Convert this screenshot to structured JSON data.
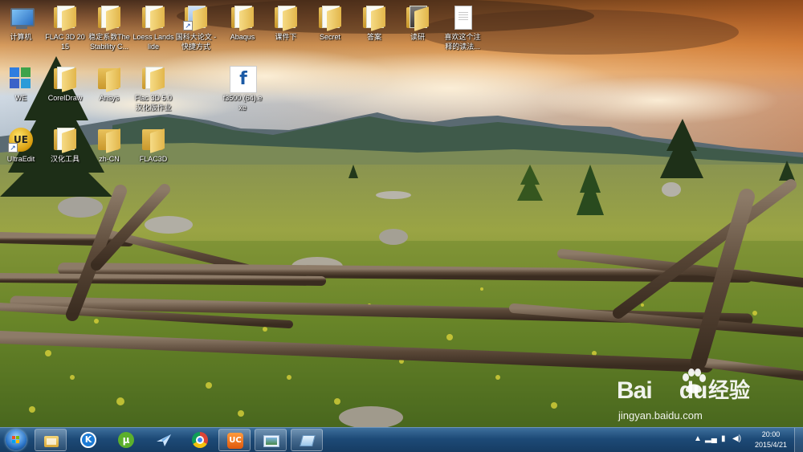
{
  "desktop": {
    "icons": [
      {
        "label": "计算机",
        "kind": "computer"
      },
      {
        "label": "FLAC 3D 2015",
        "kind": "folder"
      },
      {
        "label": "稳定系数The Stability C...",
        "kind": "folder"
      },
      {
        "label": "Loess Landslide",
        "kind": "folder"
      },
      {
        "label": "国科大论文 - 快捷方式",
        "kind": "folder-shortcut"
      },
      {
        "label": "Abaqus",
        "kind": "folder"
      },
      {
        "label": "课件下",
        "kind": "folder"
      },
      {
        "label": "Secret",
        "kind": "folder"
      },
      {
        "label": "答案",
        "kind": "folder"
      },
      {
        "label": "读研",
        "kind": "folder-photo"
      },
      {
        "label": "喜欢这个注释的读法...",
        "kind": "document"
      },
      {
        "label": "WE",
        "kind": "we-app"
      },
      {
        "label": "CorelDraw",
        "kind": "folder"
      },
      {
        "label": "Ansys",
        "kind": "folder"
      },
      {
        "label": "Flac 3D 5.0 汉化版作业",
        "kind": "folder"
      },
      {
        "label": "f3500 (64).exe",
        "kind": "exe"
      },
      {
        "label": "UltraEdit",
        "kind": "ultraedit"
      },
      {
        "label": "汉化工具",
        "kind": "folder"
      },
      {
        "label": "zh-CN",
        "kind": "folder"
      },
      {
        "label": "FLAC3D",
        "kind": "folder"
      }
    ]
  },
  "watermark": {
    "logo_text": "Bai",
    "logo_text2": "du",
    "cn_text": "经验",
    "url": "jingyan.baidu.com"
  },
  "taskbar": {
    "pinned": [
      {
        "name": "explorer",
        "icon": "folder-icon"
      },
      {
        "name": "kuaibo",
        "icon": "k-player-icon"
      },
      {
        "name": "utorrent",
        "icon": "utorrent-icon"
      },
      {
        "name": "feiq",
        "icon": "bird-icon"
      },
      {
        "name": "chrome",
        "icon": "chrome-icon"
      },
      {
        "name": "uc",
        "icon": "uc-browser-icon"
      },
      {
        "name": "picture-viewer",
        "icon": "picture-viewer-icon"
      },
      {
        "name": "notes",
        "icon": "notes-icon"
      }
    ],
    "time": "20:00",
    "date": "2015/4/21"
  },
  "colors": {
    "taskbar": "#1d4a77",
    "label_text": "#ffffff"
  }
}
